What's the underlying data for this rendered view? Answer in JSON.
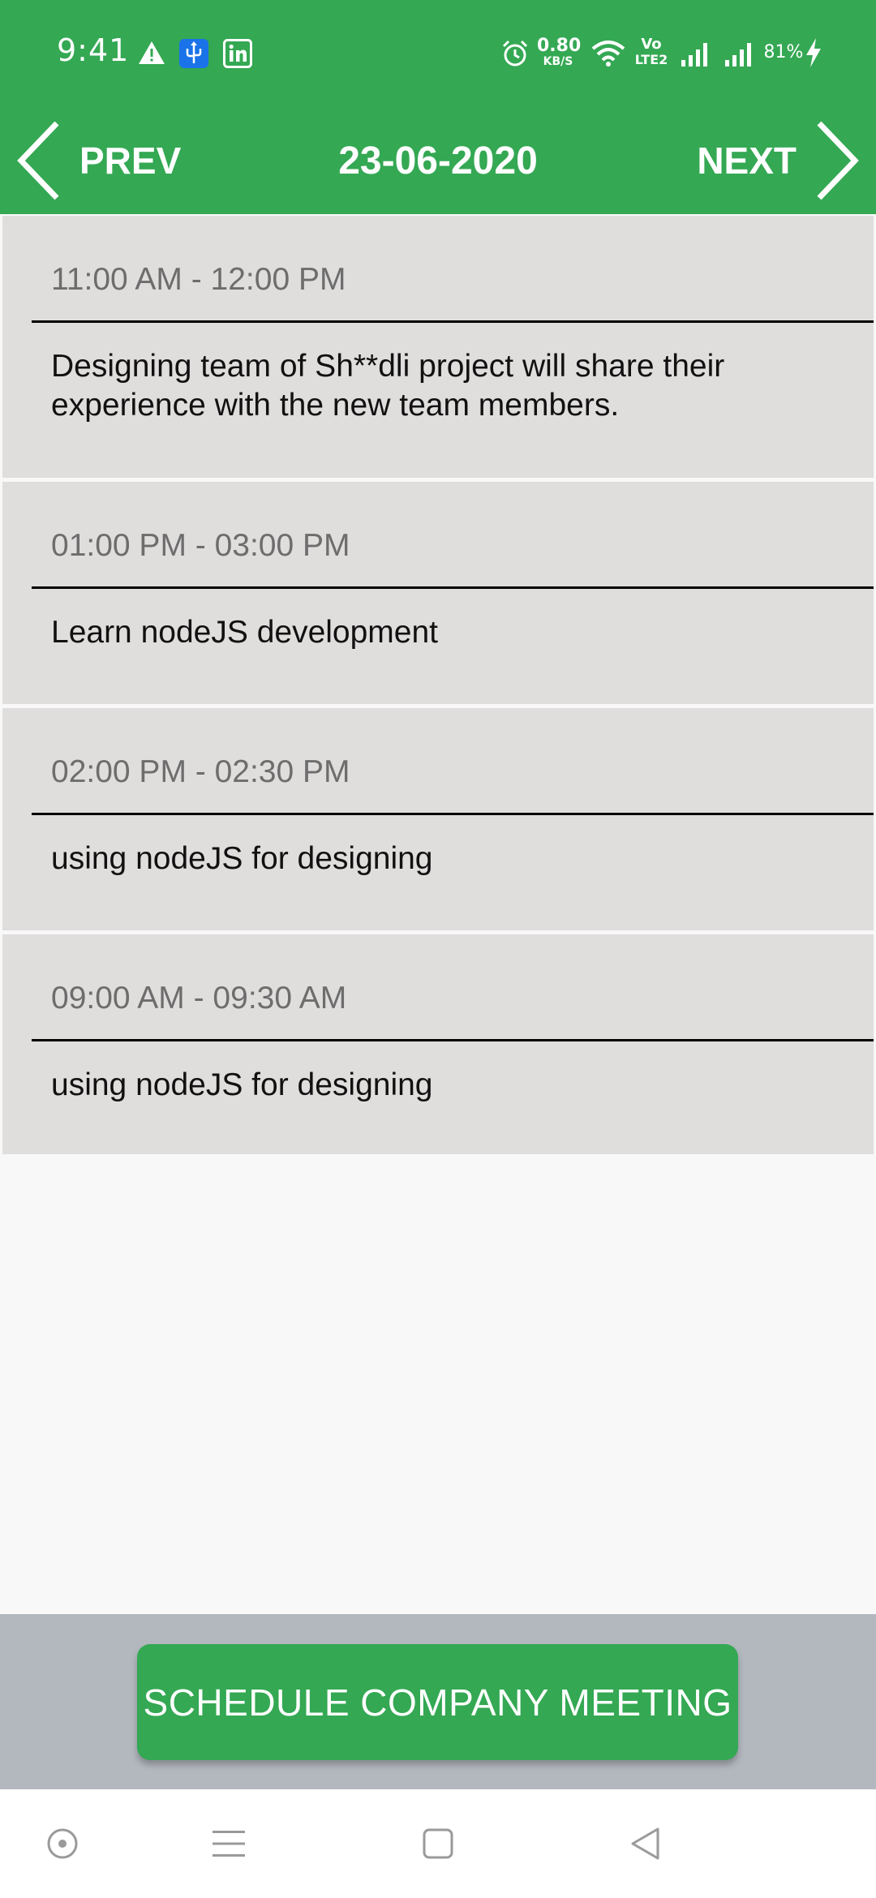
{
  "status_bar": {
    "time": "9:41",
    "network_speed_value": "0.80",
    "network_speed_unit": "KB/S",
    "volte_top": "Vo",
    "volte_bottom": "LTE2",
    "battery_percent": "81%",
    "icons": [
      "alert-triangle-icon",
      "usb-icon",
      "linkedin-icon",
      "alarm-icon",
      "wifi-icon",
      "signal-1-icon",
      "signal-2-icon",
      "charging-bolt-icon"
    ]
  },
  "nav": {
    "prev_label": "PREV",
    "date": "23-06-2020",
    "next_label": "NEXT"
  },
  "events": [
    {
      "time": "11:00 AM - 12:00 PM",
      "description": "Designing team of Sh**dli project will share their experience with the new team members."
    },
    {
      "time": "01:00 PM - 03:00 PM",
      "description": "Learn nodeJS development"
    },
    {
      "time": "02:00 PM - 02:30 PM",
      "description": "using nodeJS for designing"
    },
    {
      "time": "09:00 AM - 09:30 AM",
      "description": "using nodeJS for designing"
    }
  ],
  "action": {
    "schedule_label": "SCHEDULE COMPANY MEETING"
  },
  "system_nav": {
    "buttons": [
      "assistant-dot-icon",
      "menu-lines-icon",
      "home-square-icon",
      "back-triangle-icon"
    ]
  },
  "colors": {
    "primary_green": "#34a853",
    "card_background": "#e0dddd",
    "action_bar_background": "#b3b8bf",
    "page_background": "#f8f8f8",
    "time_text": "#6d6d6d"
  }
}
